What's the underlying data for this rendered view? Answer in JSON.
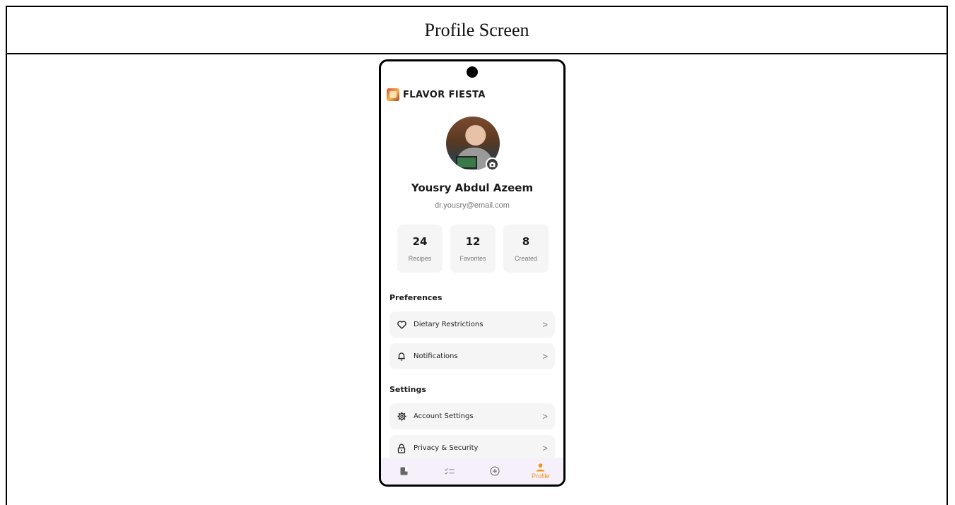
{
  "page": {
    "title": "Profile Screen"
  },
  "app": {
    "brand": "FLAVOR FIESTA",
    "brand_icon": "app-logo-icon"
  },
  "profile": {
    "name": "Yousry Abdul Azeem",
    "email": "dr.yousry@email.com",
    "avatar_icon": "avatar-photo",
    "edit_photo_icon": "camera-icon"
  },
  "stats": [
    {
      "value": "24",
      "label": "Recipes"
    },
    {
      "value": "12",
      "label": "Favorites"
    },
    {
      "value": "8",
      "label": "Created"
    }
  ],
  "preferences": {
    "title": "Preferences",
    "items": [
      {
        "label": "Dietary Restrictions",
        "icon": "heart-icon"
      },
      {
        "label": "Notifications",
        "icon": "bell-icon"
      }
    ]
  },
  "settings": {
    "title": "Settings",
    "items": [
      {
        "label": "Account Settings",
        "icon": "gear-icon"
      },
      {
        "label": "Privacy & Security",
        "icon": "lock-icon"
      }
    ]
  },
  "chevron": ">",
  "bottom_nav": {
    "items": [
      {
        "icon": "book-icon",
        "label": ""
      },
      {
        "icon": "checklist-icon",
        "label": ""
      },
      {
        "icon": "add-circle-icon",
        "label": ""
      },
      {
        "icon": "person-icon",
        "label": "Profile",
        "active": true
      }
    ]
  },
  "colors": {
    "accent": "#f0921c",
    "card_background": "#f5f5f5",
    "nav_background": "#f6f0fa",
    "text_primary": "#1a1a1a",
    "text_secondary": "#777777"
  }
}
